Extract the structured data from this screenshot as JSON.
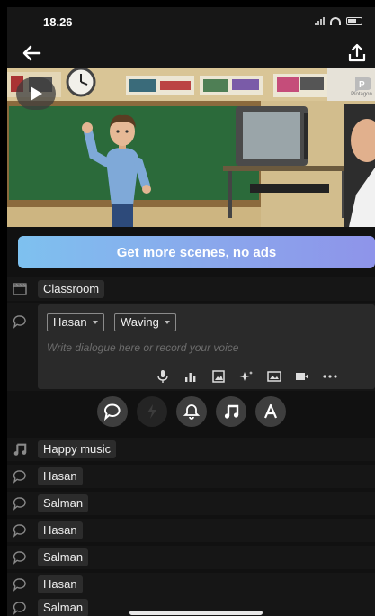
{
  "status_bar": {
    "time": "18.26"
  },
  "toolbar": {
    "back_icon": "arrow-left-icon",
    "share_icon": "share-upload-icon"
  },
  "scene": {
    "play_icon": "play-icon",
    "watermark": "Plotagon"
  },
  "promo": {
    "label": "Get more scenes, no ads"
  },
  "location": {
    "icon": "clapperboard-icon",
    "label": "Classroom"
  },
  "editor": {
    "character": "Hasan",
    "action": "Waving",
    "placeholder": "Write dialogue here or record your voice",
    "tools": [
      "microphone-icon",
      "sound-level-icon",
      "image-icon",
      "sparkle-icon",
      "landscape-icon",
      "video-camera-icon",
      "more-icon"
    ]
  },
  "actions": [
    "dialogue-icon",
    "flash-icon",
    "bell-icon",
    "music-note-icon",
    "text-icon"
  ],
  "timeline": [
    {
      "icon": "music-note-icon",
      "label": "Happy music"
    },
    {
      "icon": "speech-bubble-icon",
      "label": "Hasan"
    },
    {
      "icon": "speech-bubble-icon",
      "label": "Salman"
    },
    {
      "icon": "speech-bubble-icon",
      "label": "Hasan"
    },
    {
      "icon": "speech-bubble-icon",
      "label": "Salman"
    },
    {
      "icon": "speech-bubble-icon",
      "label": "Hasan"
    },
    {
      "icon": "speech-bubble-icon",
      "label": "Salman"
    }
  ],
  "colors": {
    "accent_start": "#7ec1ef",
    "accent_end": "#8e94ea",
    "background": "#111111"
  }
}
